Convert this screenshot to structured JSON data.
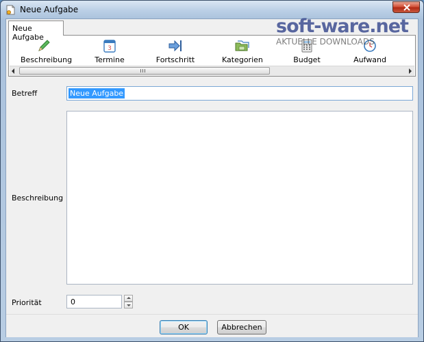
{
  "window": {
    "title": "Neue Aufgabe"
  },
  "tabs": [
    {
      "label": "Neue Aufgabe"
    }
  ],
  "toolbar": {
    "items": [
      {
        "label": "Beschreibung",
        "icon": "pencil-icon"
      },
      {
        "label": "Termine",
        "icon": "calendar-icon"
      },
      {
        "label": "Fortschritt",
        "icon": "progress-arrow-icon"
      },
      {
        "label": "Kategorien",
        "icon": "folders-icon"
      },
      {
        "label": "Budget",
        "icon": "calculator-icon"
      },
      {
        "label": "Aufwand",
        "icon": "clock-icon"
      }
    ]
  },
  "form": {
    "subject_label": "Betreff",
    "subject_value": "Neue Aufgabe",
    "description_label": "Beschreibung",
    "description_value": "",
    "priority_label": "Priorität",
    "priority_value": "0"
  },
  "buttons": {
    "ok": "OK",
    "cancel": "Abbrechen"
  },
  "watermark": {
    "brand": "soft-ware.net",
    "tagline": "AKTUELLE DOWNLOADS"
  },
  "colors": {
    "selection": "#3399ff",
    "close_button": "#c8432b",
    "title_bar": "#bcd0e6"
  }
}
